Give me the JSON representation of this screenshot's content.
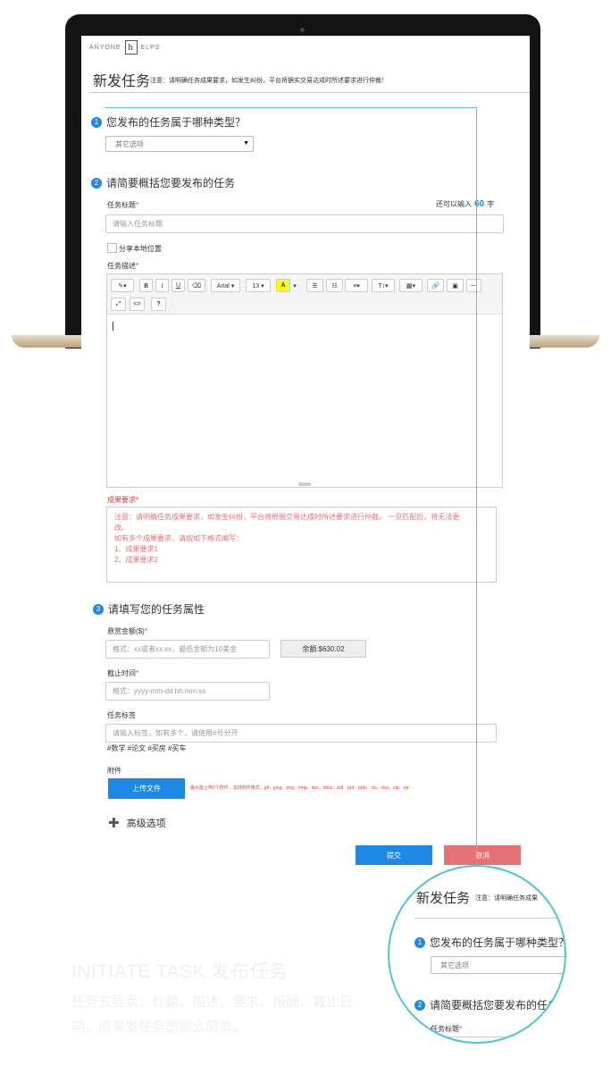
{
  "brand": {
    "left": "ANYONE",
    "logo": "h",
    "right": "ELPS"
  },
  "page": {
    "title": "新发任务",
    "note": "注意：请明确任务成果要求，如发生纠纷，平台将据实交易达成时所述要求进行仲裁！"
  },
  "step1": {
    "num": "1",
    "title": "您发布的任务属于哪种类型？",
    "select_value": "其它选项",
    "arrow": "▼"
  },
  "step2": {
    "num": "2",
    "title": "请简要概括您要发布的任务",
    "task_title_label": "任务标题",
    "required_mark": "*",
    "counter_prefix": "还可以输入",
    "counter_value": "60",
    "counter_unit": "字",
    "task_title_placeholder": "请输入任务标题",
    "share_location_label": "分享本地位置",
    "desc_label": "任务描述"
  },
  "toolbar": {
    "style": "✎▾",
    "bold": "B",
    "italic": "I",
    "underline": "U",
    "eraser": "⌫",
    "font": "Arial ▾",
    "size": "13 ▾",
    "color": "A",
    "color_arrow": "▾",
    "ul": "☰",
    "ol": "☷",
    "align": "≡▾",
    "height": "T↕▾",
    "table": "▦▾",
    "link": "🔗",
    "picture": "▣",
    "hr": "—",
    "fullscreen": "⤢",
    "code": "<>",
    "help": "?"
  },
  "result": {
    "label": "成果要求",
    "required_mark": "*",
    "lines": [
      "注意：请明确任务成果要求，如发生纠纷，平台将根据交易达成时所述要求进行仲裁。 一旦匹配后，将无法更",
      "改。",
      "如有多个成果要求，请按如下格式编写：",
      "1、成果要求1",
      "2、成果要求2"
    ]
  },
  "step3": {
    "num": "3",
    "title": "请填写您的任务属性",
    "reward_label": "悬赏金额($)",
    "required_mark": "*",
    "reward_placeholder": "格式：xx或者xx.xx，最低金额为10美金",
    "balance": "余额:$630.02",
    "deadline_label": "截止时间",
    "deadline_placeholder": "格式：yyyy-mm-dd hh:mm:ss",
    "tags_label": "任务标签",
    "tags_placeholder": "请输入标签，如有多个，请使用#号分开",
    "tag_examples": "#数学 #论文 #买房 #买车",
    "attachment_label": "附件",
    "upload_button": "上传文件",
    "upload_hint": "最大能上传5个附件，支持附件格式：gif、jpeg、png、bmp、doc、docx、pdf、ppt、pptx、xls、xlsx、zip、rar",
    "advanced": "高级选项",
    "advanced_icon": "✚"
  },
  "actions": {
    "submit": "提交",
    "cancel": "取消"
  },
  "magnifier": {
    "title": "新发任务",
    "note": "注意：请明确任务成果",
    "step1_num": "1",
    "step1_title": "您发布的任务属于哪种类型？",
    "select_value": "其它选项",
    "step2_num": "2",
    "step2_title": "请简要概括您要发布的任务",
    "task_title_label": "任务标题",
    "required_mark": "*"
  },
  "promo": {
    "title": "INITIATE TASK 发布任务",
    "text": "任务五要素：标题、描述、要求、报酬、截止日期，原来发任务是那么简单。"
  },
  "colors": {
    "accent": "#1e88e5",
    "cancel": "#e57373",
    "highlight": "#5bc0d9",
    "required": "#e53935"
  }
}
